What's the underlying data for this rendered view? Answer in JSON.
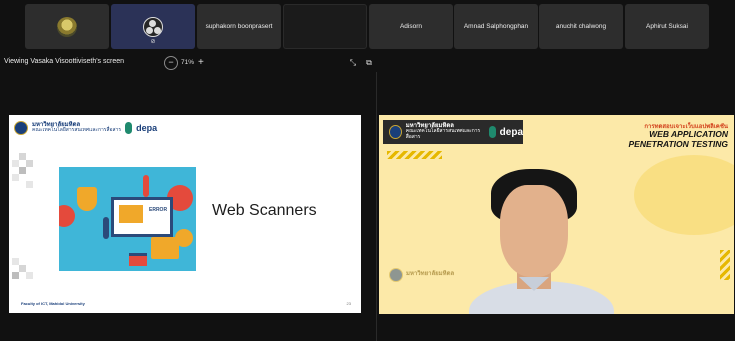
{
  "participants": [
    {
      "name": "",
      "type": "avatar"
    },
    {
      "name": "",
      "type": "obs",
      "active": true
    },
    {
      "name": "suphakorn boonprasert"
    },
    {
      "name": ""
    },
    {
      "name": "Adisorn"
    },
    {
      "name": "Amnad Salphongphan"
    },
    {
      "name": "anuchit chalwong"
    },
    {
      "name": "Aphirut Suksai"
    }
  ],
  "view_bar": {
    "title": "Viewing Vasaka Visoottiviseth's screen",
    "zoom_out": "−",
    "zoom_level": "71%",
    "zoom_in": "+"
  },
  "slide": {
    "university": "มหาวิทยาลัยมหิดล",
    "faculty": "คณะเทคโนโลยีสารสนเทศและการสื่อสาร",
    "depa_brand": "depa",
    "title": "Web Scanners",
    "illustration_tag": "ERROR",
    "footer": "Faculty of ICT, Mahidol University",
    "page_number": "23"
  },
  "video": {
    "university": "มหาวิทยาลัยมหิดล",
    "faculty": "คณะเทคโนโลยีสารสนเทศและการสื่อสาร",
    "depa_brand": "depa",
    "course_thai": "การทดสอบเจาะเว็บแอปพลิเคชัน",
    "course_line1": "WEB APPLICATION",
    "course_line2": "PENETRATION TESTING"
  },
  "colors": {
    "background": "#111111",
    "tile": "#2d2d2d",
    "active_tile": "#2b3257",
    "video_bg": "#fce9a8",
    "accent_red": "#d3451f"
  }
}
